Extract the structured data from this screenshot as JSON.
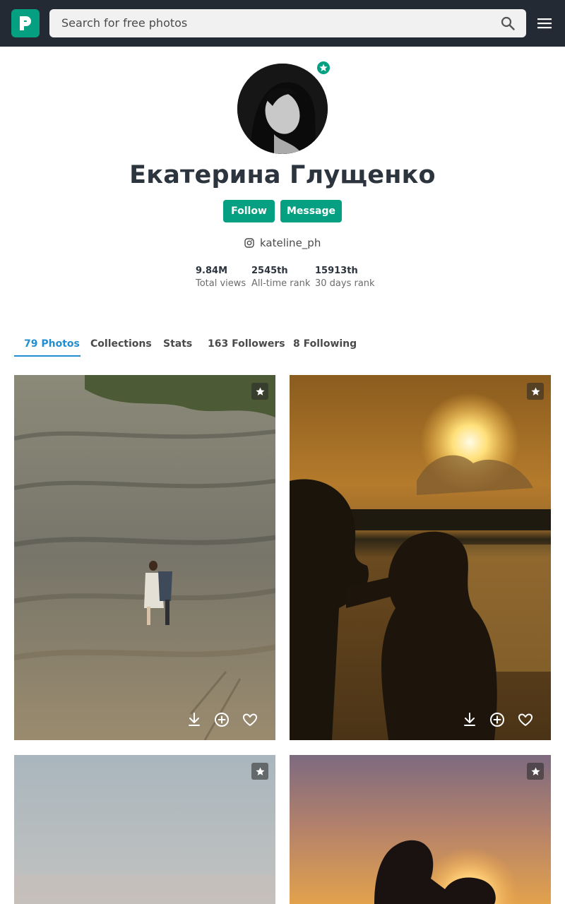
{
  "header": {
    "logo_letter": "P",
    "search_placeholder": "Search for free photos",
    "icons": [
      "logo-icon",
      "search-icon",
      "menu-icon"
    ]
  },
  "profile": {
    "name": "Екатерина Глущенко",
    "follow_label": "Follow",
    "message_label": "Message",
    "instagram": "kateline_ph",
    "stats": [
      {
        "value": "9.84M",
        "label": "Total views"
      },
      {
        "value": "2545th",
        "label": "All-time rank"
      },
      {
        "value": "15913th",
        "label": "30 days rank"
      }
    ]
  },
  "tabs": [
    {
      "label": "79 Photos",
      "active": true
    },
    {
      "label": "Collections",
      "active": false
    },
    {
      "label": "Stats",
      "active": false
    },
    {
      "label": "163 Followers",
      "active": false
    },
    {
      "label": "8 Following",
      "active": false
    }
  ],
  "colors": {
    "brand": "#05a081",
    "header_bg": "#232a34",
    "active_tab": "#1f8fd1"
  }
}
